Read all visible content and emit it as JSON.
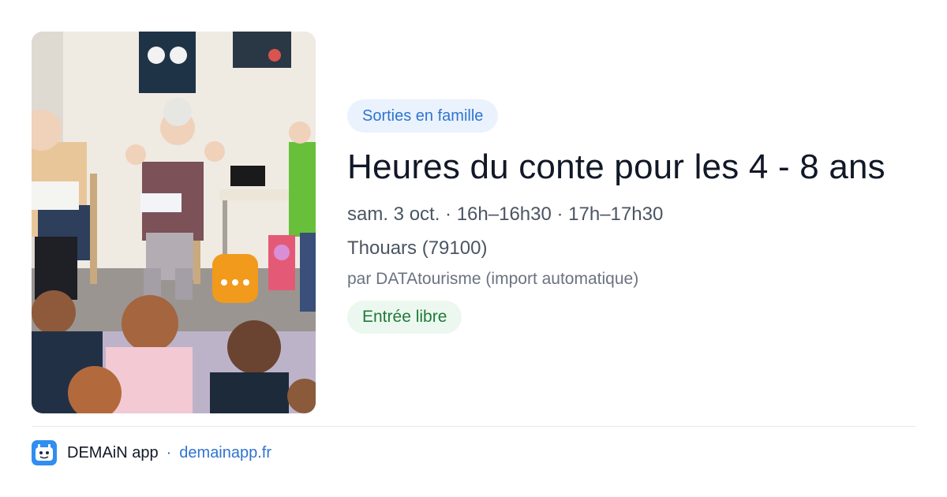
{
  "event": {
    "category": "Sorties en famille",
    "title": "Heures du conte pour les 4 - 8 ans",
    "dates": "sam. 3 oct. · 16h–16h30 · 17h–17h30",
    "location": "Thouars (79100)",
    "organizer": "par DATAtourisme (import automatique)",
    "price": "Entrée libre"
  },
  "footer": {
    "app_name": "DEMAiN app",
    "separator": "·",
    "domain": "demainapp.fr"
  },
  "colors": {
    "accent_blue": "#2f74d0",
    "category_bg": "#eaf2fd",
    "price_green": "#1f7a3a",
    "price_bg": "#ecf8ef"
  }
}
